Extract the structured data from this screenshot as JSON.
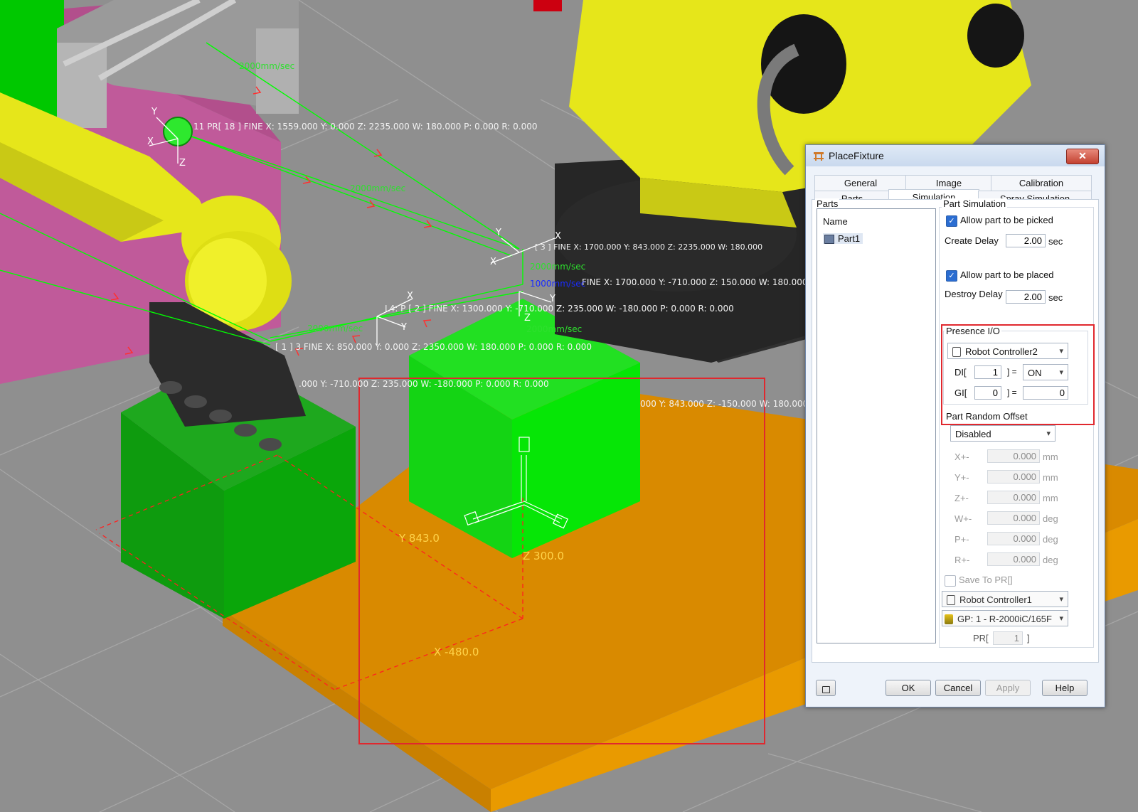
{
  "viewport": {
    "point_labels": [
      {
        "text": "11 PR[ 18 ] FINE X: 1559.000 Y: 0.000 Z: 2235.000 W: 180.000 P: 0.000 R: 0.000"
      },
      {
        "text": "L4: P [ 2 ]   FINE X: 1300.000 Y: -710.000 Z: 235.000 W: -180.000 P: 0.000 R: 0.000"
      },
      {
        "text": "[ 1 ] 3 FINE X: 850.000 Y: 0.000 Z: 2350.000 W: 180.000 P: 0.000 R: 0.000"
      },
      {
        "text": ".000 Y: -710.000 Z: 235.000 W: -180.000 P: 0.000 R: 0.000"
      },
      {
        "text": "FINE X: 1700.000 Y: -710.000 Z: 150.000 W: 180.000 R"
      },
      {
        "text": "000 Y: 843.000 Z: -150.000 W: 180.000 P:"
      },
      {
        "text": "[ 3 ] FINE X: 1700.000 Y: 843.000 Z: 2235.000 W: 180.000"
      }
    ],
    "speed_labels": [
      "2000mm/sec",
      "2000mm/sec",
      "2000mm/sec",
      "2000mm/sec",
      "2000mm/sec",
      "1000mm/sec"
    ],
    "axis_letters": [
      "X",
      "Y",
      "Z"
    ],
    "dimension_labels": {
      "y": "Y 843.0",
      "z": "Z 300.0",
      "x": "X -480.0"
    },
    "colors": {
      "floor": "#8f8f8f",
      "grid": "#a6a6a6",
      "robot": "#e6e61a",
      "robot_dark": "#2e2e2e",
      "fixture_box": "#00cc00",
      "pallet": "#e89400",
      "magenta_zone": "#c05a9a",
      "path_line": "#00ff00",
      "path_arrow": "#ff3030",
      "highlight": "#e0282e"
    }
  },
  "dialog": {
    "title": "PlaceFixture",
    "title_icon": "fixture-icon",
    "close_label": "✕",
    "tabs_row1": [
      "General",
      "Image",
      "Calibration"
    ],
    "tabs_row2": [
      "Parts",
      "Simulation",
      "Spray Simulation"
    ],
    "active_tab": "Simulation",
    "parts": {
      "group_label": "Parts",
      "column_header": "Name",
      "items": [
        {
          "label": "Part1",
          "icon": "part-icon"
        }
      ]
    },
    "part_simulation": {
      "group_label": "Part Simulation",
      "allow_picked_label": "Allow part to be picked",
      "allow_picked": true,
      "create_delay_label": "Create Delay",
      "create_delay_value": "2.00",
      "create_delay_unit": "sec",
      "allow_placed_label": "Allow part to be placed",
      "allow_placed": true,
      "destroy_delay_label": "Destroy Delay",
      "destroy_delay_value": "2.00",
      "destroy_delay_unit": "sec"
    },
    "presence_io": {
      "group_label": "Presence I/O",
      "controller": "Robot Controller2",
      "di_label_open": "DI[",
      "di_index": "1",
      "di_label_close": "] =",
      "di_value": "ON",
      "gi_label_open": "GI[",
      "gi_index": "0",
      "gi_label_close": "] =",
      "gi_value": "0"
    },
    "random_offset": {
      "group_label": "Part Random Offset",
      "mode": "Disabled",
      "rows": [
        {
          "label": "X+-",
          "value": "0.000",
          "unit": "mm"
        },
        {
          "label": "Y+-",
          "value": "0.000",
          "unit": "mm"
        },
        {
          "label": "Z+-",
          "value": "0.000",
          "unit": "mm"
        },
        {
          "label": "W+-",
          "value": "0.000",
          "unit": "deg"
        },
        {
          "label": "P+-",
          "value": "0.000",
          "unit": "deg"
        },
        {
          "label": "R+-",
          "value": "0.000",
          "unit": "deg"
        }
      ],
      "save_to_pr_label": "Save To PR[]",
      "save_to_pr": false,
      "save_controller": "Robot Controller1",
      "save_group": "GP: 1 - R-2000iC/165F",
      "pr_label_open": "PR[",
      "pr_index": "1",
      "pr_label_close": "]"
    },
    "buttons": {
      "ok": "OK",
      "cancel": "Cancel",
      "apply": "Apply",
      "help": "Help"
    }
  }
}
